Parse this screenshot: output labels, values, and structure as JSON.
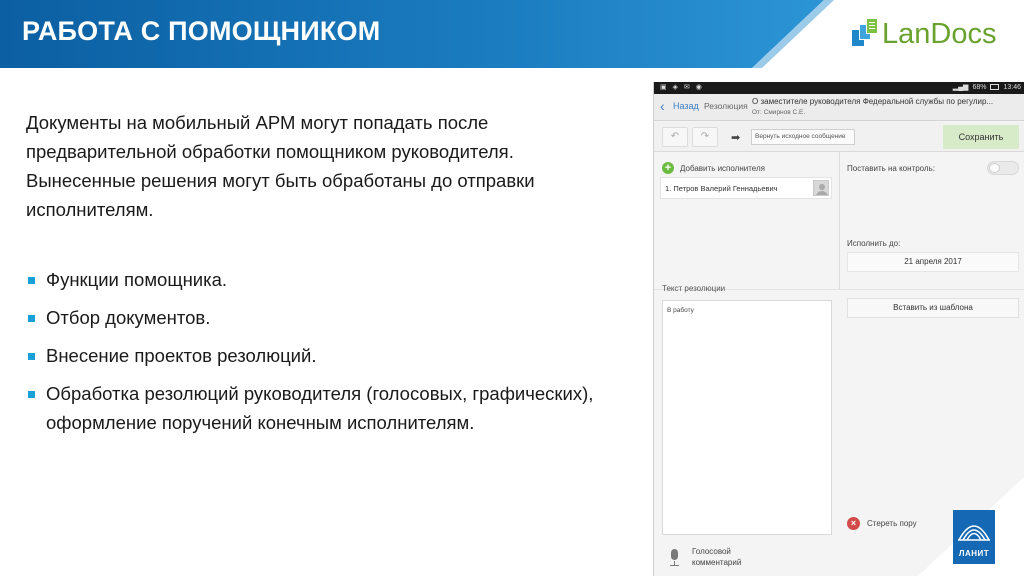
{
  "colors": {
    "banner_dark": "#0b5fa2",
    "banner_light": "#2c95d5",
    "bullet": "#1aa0d8",
    "brand_green": "#6aa22f",
    "lanit_blue": "#1468b4"
  },
  "header": {
    "title": "РАБОТА С ПОМОЩНИКОМ",
    "brand": {
      "icon": "landocs-logo-icon",
      "text": "LanDocs"
    }
  },
  "content": {
    "intro": "Документы на мобильный АРМ могут попадать после предварительной обработки помощником руководителя. Вынесенные решения могут быть обработаны до отправки исполнителям.",
    "bullets": [
      "Функции помощника.",
      "Отбор документов.",
      "Внесение проектов резолюций.",
      "Обработка резолюций руководителя (голосовых, графических), оформление поручений конечным исполнителям."
    ]
  },
  "tablet": {
    "status": {
      "battery": "68%",
      "time": "13:46"
    },
    "appbar": {
      "back_label": "Назад",
      "breadcrumb": "Резолюция",
      "doc_title": "О заместителе руководителя Федеральной службы по регулир...",
      "doc_sub": "От: Смирнов С.Е."
    },
    "toolbar": {
      "undo_icon": "undo-icon",
      "redo_icon": "redo-icon",
      "return_label": "Вернуть исходное сообщение",
      "save_label": "Сохранить"
    },
    "executors": {
      "add_label": "Добавить исполнителя",
      "items": [
        "1. Петров Валерий Геннадьевич"
      ]
    },
    "control": {
      "label": "Поставить на контроль:",
      "enabled": false
    },
    "due": {
      "label": "Исполнить до:",
      "value": "21 апреля 2017"
    },
    "resolution": {
      "label": "Текст резолюции",
      "value": "В работу"
    },
    "template_label": "Вставить из шаблона",
    "erase_label": "Стереть пору",
    "voice_label": "Голосовой комментарий"
  },
  "corner": {
    "logo_text": "ЛАНИТ"
  }
}
